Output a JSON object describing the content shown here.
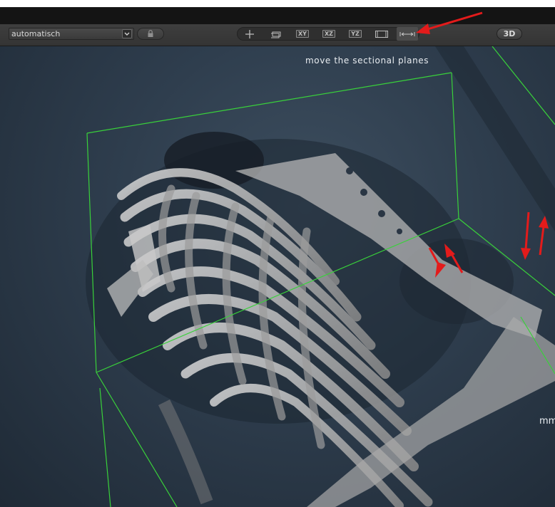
{
  "toolbar": {
    "mode_select": {
      "value": "automatisch"
    },
    "view_buttons": [
      {
        "id": "crosshair",
        "icon": "crosshair-icon",
        "label": ""
      },
      {
        "id": "slab",
        "icon": "slab-icon",
        "label": ""
      },
      {
        "id": "xy",
        "icon": "plane-xy-icon",
        "label": "XY"
      },
      {
        "id": "xz",
        "icon": "plane-xz-icon",
        "label": "XZ"
      },
      {
        "id": "yz",
        "icon": "plane-yz-icon",
        "label": "YZ"
      },
      {
        "id": "film",
        "icon": "frame-icon",
        "label": ""
      },
      {
        "id": "move-planes",
        "icon": "move-sectional-planes-icon",
        "label": ""
      }
    ],
    "mode_3d_label": "3D",
    "active_button": "move-planes"
  },
  "viewport": {
    "hint": "move the sectional planes",
    "units_label": "mm",
    "bounding_box_color": "#39d13a",
    "annotation_color": "#e31b1b"
  }
}
